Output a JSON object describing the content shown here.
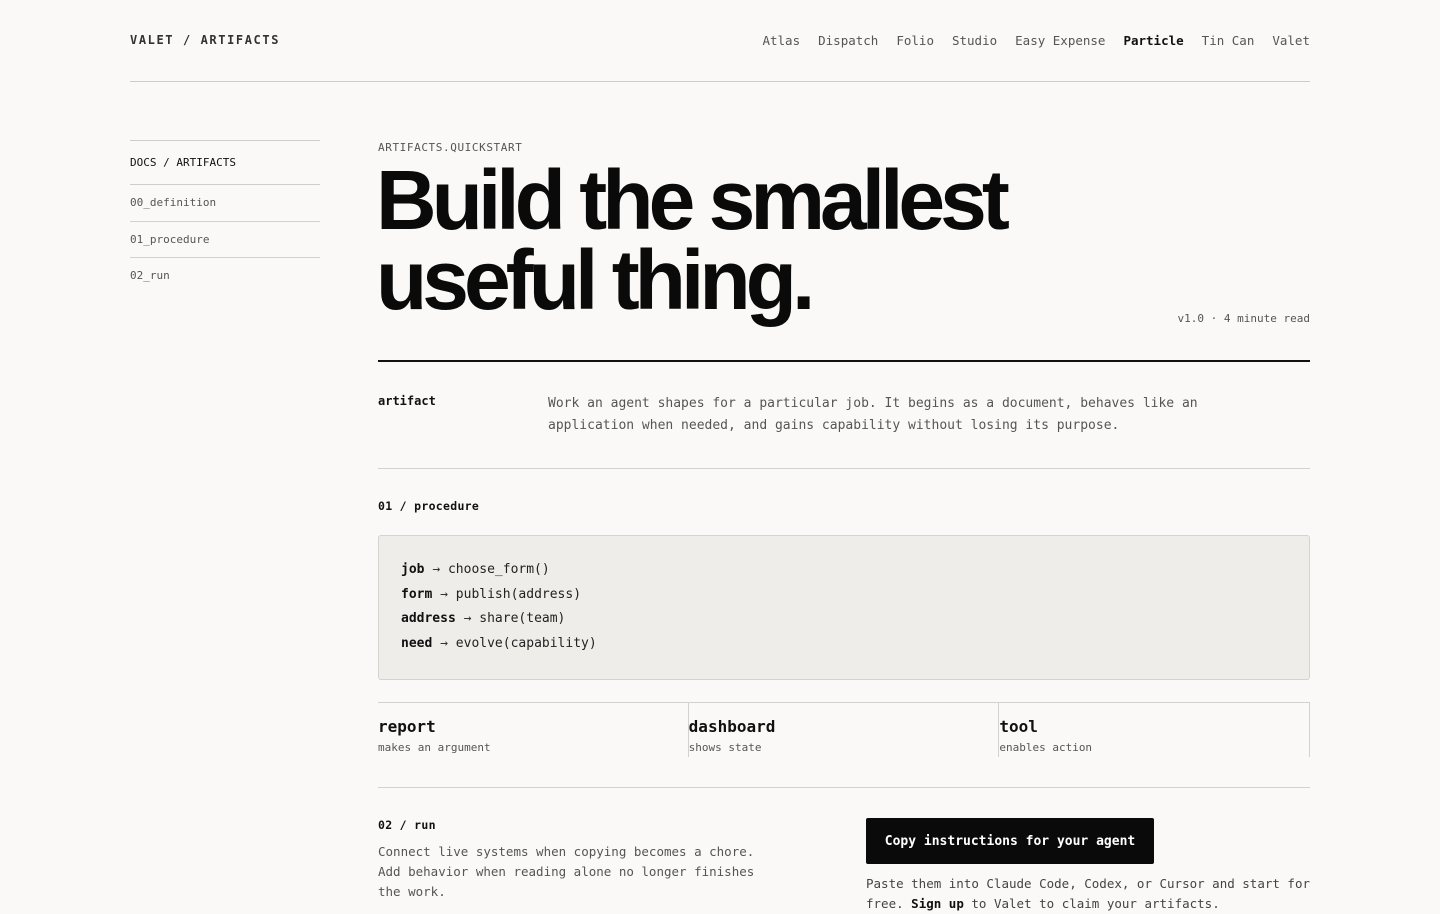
{
  "brand": "VALET / ARTIFACTS",
  "nav": {
    "items": [
      "Atlas",
      "Dispatch",
      "Folio",
      "Studio",
      "Easy Expense",
      "Particle",
      "Tin Can",
      "Valet"
    ],
    "active": "Particle"
  },
  "sidebar": {
    "heading": "DOCS / ARTIFACTS",
    "items": [
      "00_definition",
      "01_procedure",
      "02_run"
    ]
  },
  "eyebrow": "ARTIFACTS.QUICKSTART",
  "headline": {
    "line1": "Build the smallest",
    "line2": "useful thing."
  },
  "meta": "v1.0 · 4 minute read",
  "definition": {
    "term": "artifact",
    "text": "Work an agent shapes for a particular job. It begins as a document, behaves like an application when needed, and gains capability without losing its purpose."
  },
  "procedure": {
    "label": "01 / procedure",
    "lines": [
      {
        "key": "job",
        "arrow": "→",
        "call": "choose_form()"
      },
      {
        "key": "form",
        "arrow": "→",
        "call": "publish(address)"
      },
      {
        "key": "address",
        "arrow": "→",
        "call": "share(team)"
      },
      {
        "key": "need",
        "arrow": "→",
        "call": "evolve(capability)"
      }
    ],
    "cards": [
      {
        "title": "report",
        "subtitle": "makes an argument"
      },
      {
        "title": "dashboard",
        "subtitle": "shows state"
      },
      {
        "title": "tool",
        "subtitle": "enables action"
      }
    ]
  },
  "run": {
    "label": "02 / run",
    "text": "Connect live systems when copying becomes a chore. Add behavior when reading alone no longer finishes the work.",
    "cta_label": "Copy instructions for your agent",
    "cta_text_before": "Paste them into Claude Code, Codex, or Cursor and start for free.",
    "cta_link": "Sign up",
    "cta_text_after": "to Valet to claim your artifacts."
  }
}
